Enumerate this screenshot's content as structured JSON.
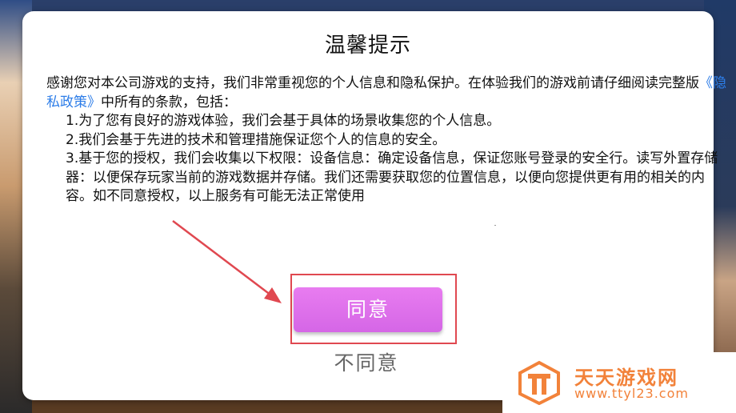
{
  "dialog": {
    "title": "温馨提示",
    "intro_prefix": "感谢您对本公司游戏的支持，我们非常重视您的个人信息和隐私保护。在体验我们的游戏前请仔细阅读完整版",
    "privacy_link": "《隐私政策》",
    "intro_suffix": "中所有的条款，包括：",
    "items": [
      "1.为了您有良好的游戏体验，我们会基于具体的场景收集您的个人信息。",
      "2.我们会基于先进的技术和管理措施保证您个人的信息的安全。",
      "3.基于您的授权，我们会收集以下权限：设备信息：确定设备信息，保证您账号登录的安全行。读写外置存储器：以便保存玩家当前的游戏数据并存储。我们还需要获取您的位置信息，以便向您提供更有用的相关的内容。如不同意授权，以上服务有可能无法正常使用"
    ],
    "agree_label": "同意",
    "disagree_label": "不同意"
  },
  "watermark": {
    "name": "天天游戏网",
    "url": "www.ttyl23.com"
  },
  "colors": {
    "accent_button": "#d96ae8",
    "link": "#2d7de8",
    "annotation": "#e04850",
    "watermark": "#f2823a"
  },
  "icons": {
    "annotation_arrow": "arrow-icon",
    "watermark_logo": "logo-icon"
  }
}
